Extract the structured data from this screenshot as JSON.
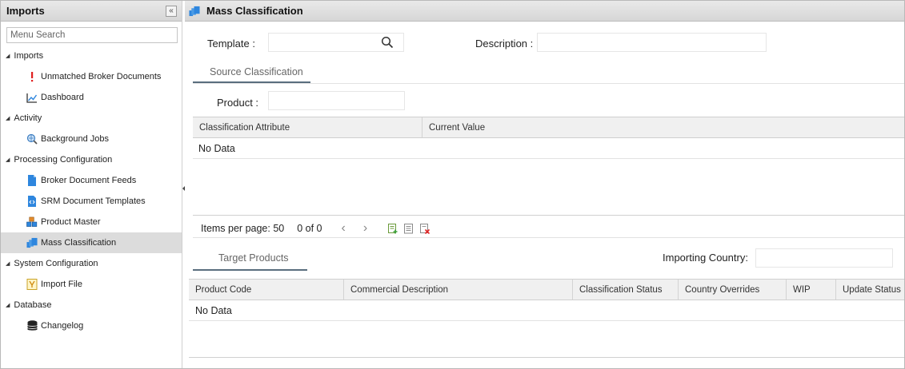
{
  "sidebar": {
    "title": "Imports",
    "collapse_glyph": "«",
    "search_placeholder": "Menu Search",
    "groups": [
      {
        "label": "Imports",
        "items": [
          {
            "label": "Unmatched Broker Documents",
            "icon": "alert-icon"
          },
          {
            "label": "Dashboard",
            "icon": "line-chart-icon"
          }
        ]
      },
      {
        "label": "Activity",
        "items": [
          {
            "label": "Background Jobs",
            "icon": "search-globe-icon"
          }
        ]
      },
      {
        "label": "Processing Configuration",
        "items": [
          {
            "label": "Broker Document Feeds",
            "icon": "document-icon"
          },
          {
            "label": "SRM Document Templates",
            "icon": "code-document-icon"
          },
          {
            "label": "Product Master",
            "icon": "cubes-icon"
          },
          {
            "label": "Mass Classification",
            "icon": "stacked-folders-icon",
            "selected": true
          }
        ]
      },
      {
        "label": "System Configuration",
        "items": [
          {
            "label": "Import File",
            "icon": "import-file-icon"
          }
        ]
      },
      {
        "label": "Database",
        "items": [
          {
            "label": "Changelog",
            "icon": "database-icon"
          }
        ]
      }
    ]
  },
  "main": {
    "title": "Mass Classification",
    "template_label": "Template :",
    "template_value": "",
    "description_label": "Description :",
    "description_value": "",
    "source_tab": "Source Classification",
    "product_label": "Product :",
    "product_value": "",
    "source_grid": {
      "columns": [
        "Classification Attribute",
        "Current Value"
      ],
      "empty_text": "No Data"
    },
    "pager": {
      "items_per_page": "Items per page: 50",
      "range": "0 of 0",
      "prev": "‹",
      "next": "›"
    },
    "target_tab": "Target Products",
    "importing_country_label": "Importing Country:",
    "importing_country_value": "",
    "target_grid": {
      "columns": [
        "Product Code",
        "Commercial Description",
        "Classification Status",
        "Country Overrides",
        "WIP",
        "Update Status"
      ],
      "empty_text": "No Data"
    }
  },
  "colors": {
    "header_bg": "#dcdcdc",
    "tab_underline": "#5a6e7e",
    "selected_item_bg": "#dcdcdc",
    "icon_blue": "#2e86de",
    "alert_red": "#e02020"
  }
}
